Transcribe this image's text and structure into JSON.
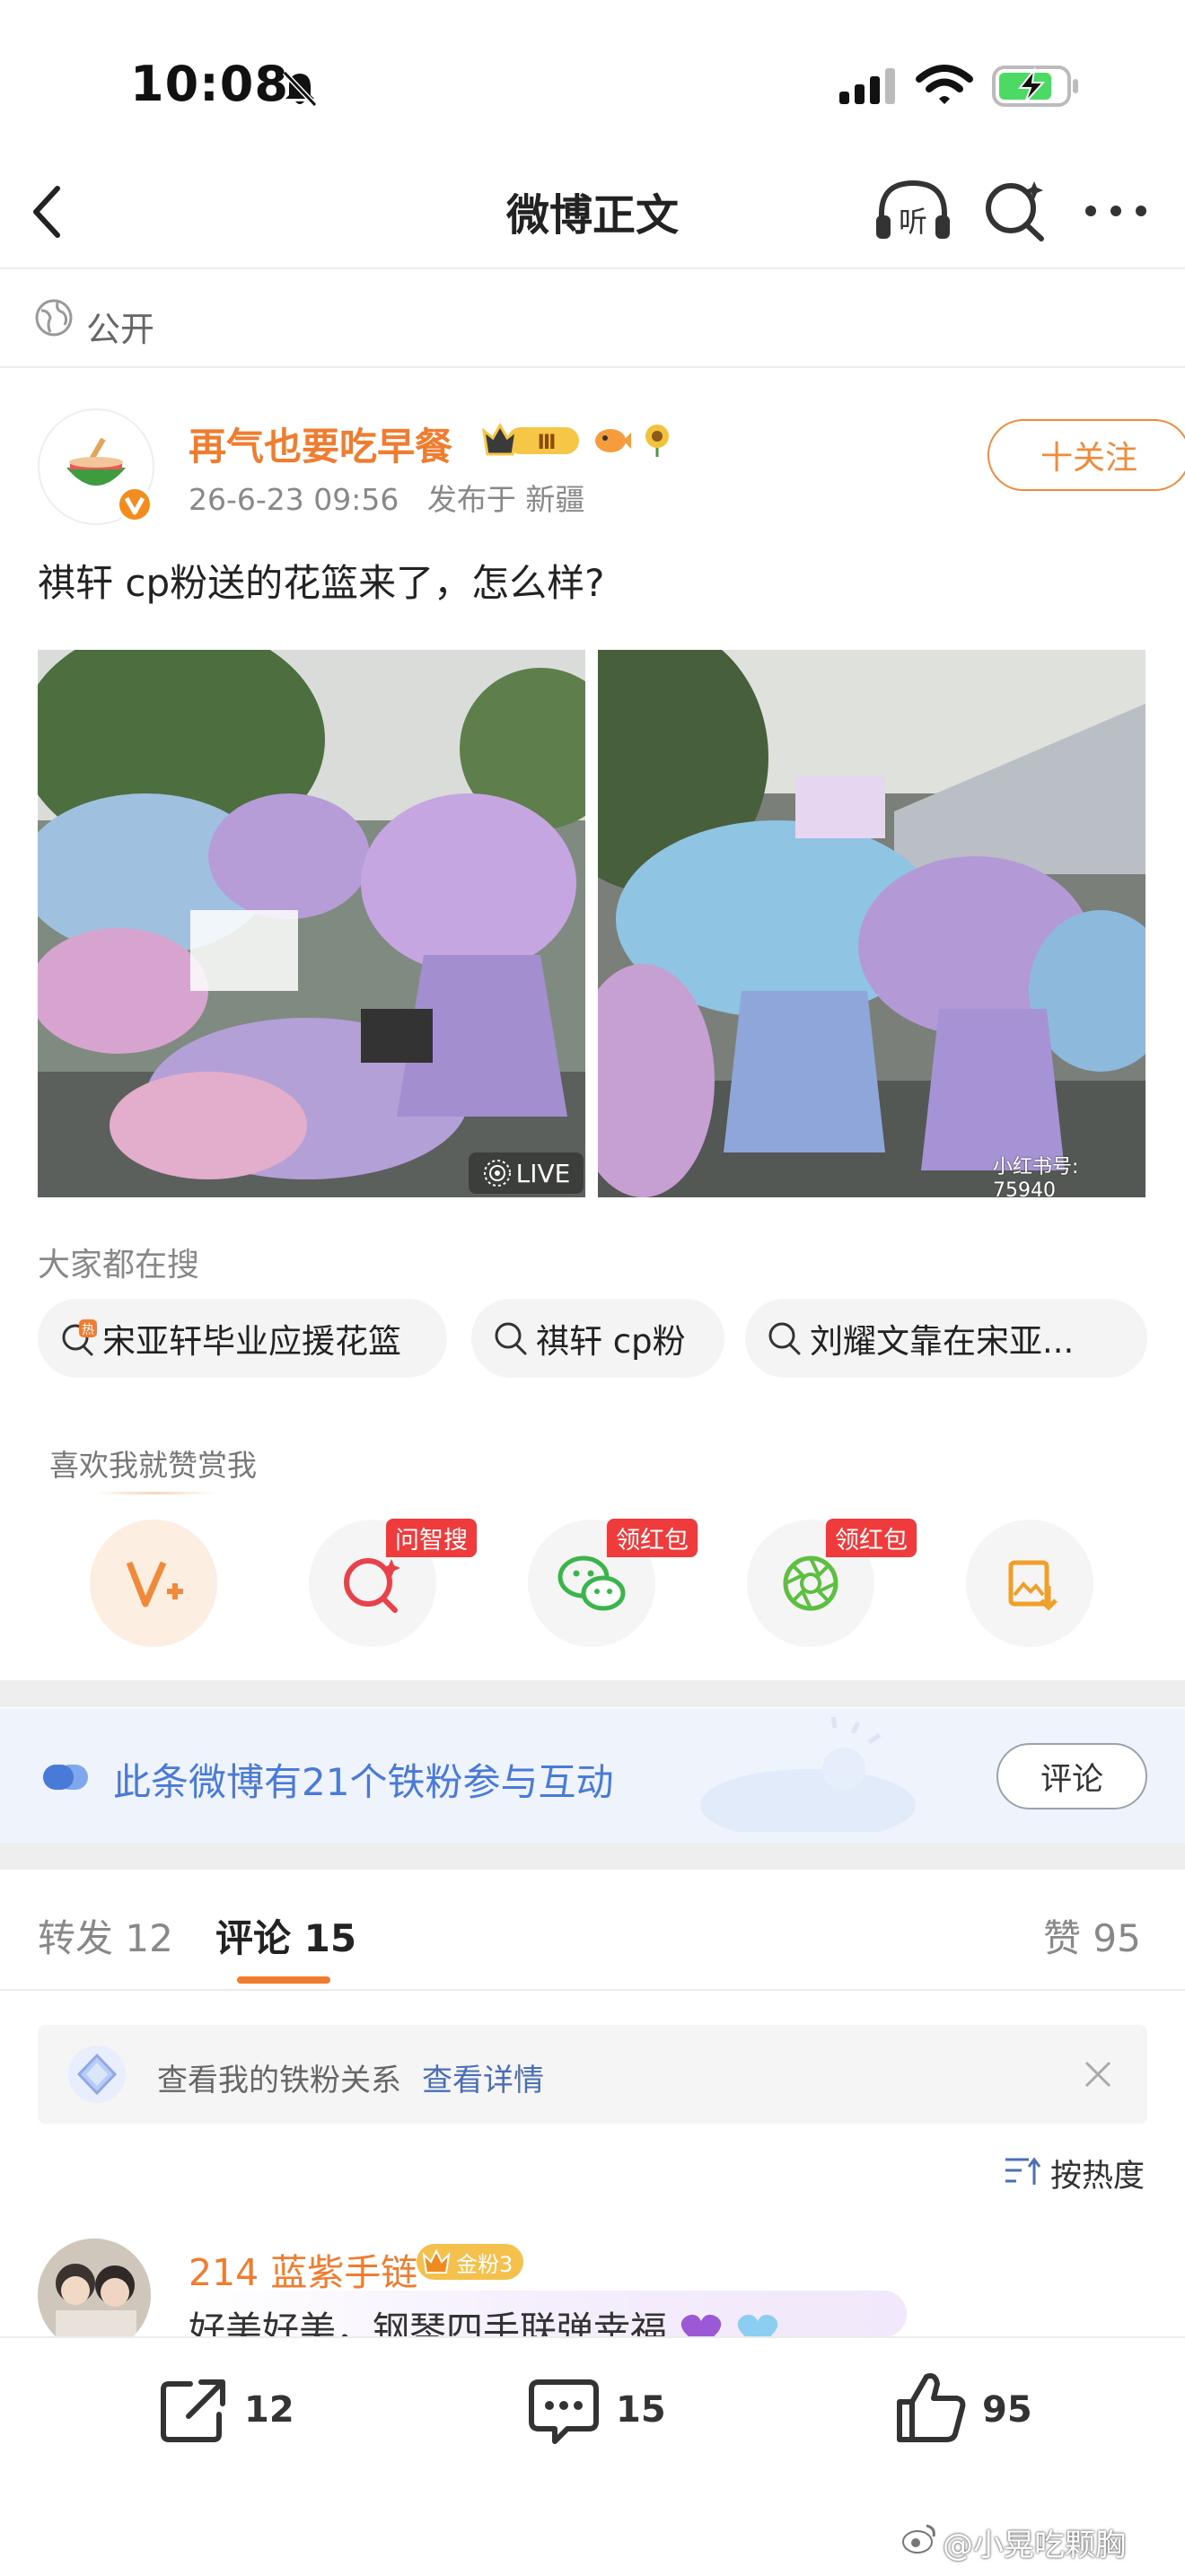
{
  "status_bar": {
    "time": "10:08"
  },
  "nav": {
    "title": "微博正文"
  },
  "visibility": "公开",
  "post": {
    "author": "再气也要吃早餐",
    "timestamp": "26-6-23 09:56",
    "location": "发布于 新疆",
    "follow_label": "十关注",
    "text": "祺轩 cp粉送的花篮来了，怎么样?",
    "live_label": "LIVE",
    "image2_watermark": "小红书号: 75940"
  },
  "search": {
    "title": "大家都在搜",
    "chips": [
      "宋亚轩毕业应援花篮",
      "祺轩 cp粉",
      "刘耀文靠在宋亚..."
    ]
  },
  "reward": {
    "title": "喜欢我就赞赏我",
    "badges": [
      "问智搜",
      "领红包",
      "领红包"
    ]
  },
  "fans_banner": {
    "text": "此条微博有21个铁粉参与互动",
    "button": "评论"
  },
  "tabs": {
    "repost": "转发",
    "repost_count": "12",
    "comment": "评论",
    "comment_count": "15",
    "like": "赞",
    "like_count": "95"
  },
  "notice": {
    "text": "查看我的铁粉关系",
    "link": "查看详情"
  },
  "sort_label": "按热度",
  "comment": {
    "name": "214 蓝紫手链",
    "badge": "金粉3",
    "text": "好美好美，钢琴四手联弹幸福"
  },
  "bottom_bar": {
    "repost_count": "12",
    "comment_count": "15",
    "like_count": "95"
  },
  "watermark": "@小晃吃颗胸",
  "colors": {
    "accent": "#f07c2f",
    "link": "#4a6fb5",
    "banner_text": "#4a7ad8",
    "badge": "#ef3b3b"
  }
}
